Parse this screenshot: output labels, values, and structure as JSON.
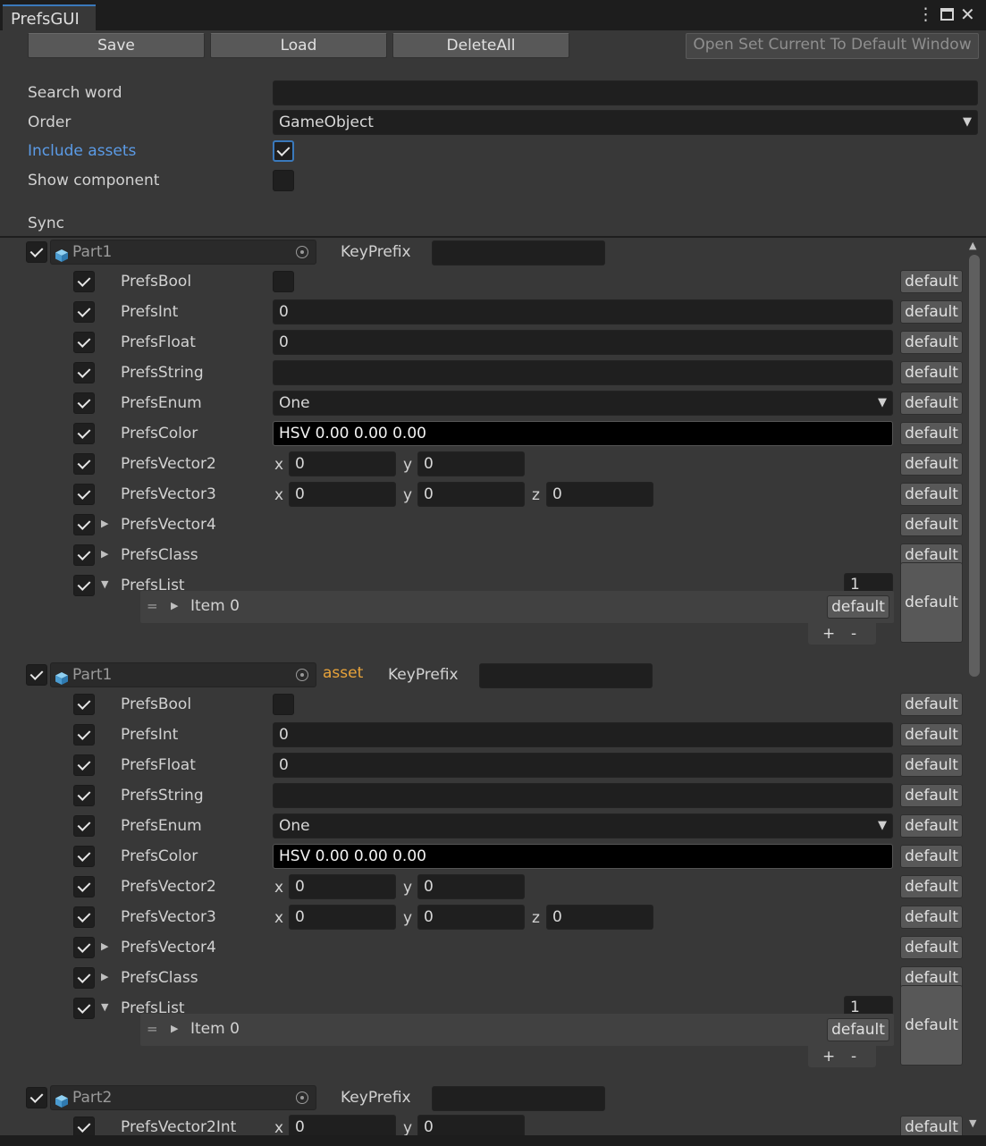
{
  "window": {
    "tab_title": "PrefsGUI"
  },
  "toolbar": {
    "save": "Save",
    "load": "Load",
    "delete_all": "DeleteAll",
    "open_default": "Open Set Current To Default Window"
  },
  "options": {
    "search_label": "Search word",
    "search_value": "",
    "order_label": "Order",
    "order_value": "GameObject",
    "include_assets_label": "Include assets",
    "include_assets_checked": true,
    "show_component_label": "Show component",
    "show_component_checked": false
  },
  "sync_label": "Sync",
  "groups": [
    {
      "object": "Part1",
      "tag": "",
      "keyprefix_label": "KeyPrefix",
      "keyprefix_value": "",
      "checked": true,
      "items": [
        {
          "name": "PrefsBool",
          "type": "bool",
          "value": false
        },
        {
          "name": "PrefsInt",
          "type": "field",
          "value": "0"
        },
        {
          "name": "PrefsFloat",
          "type": "field",
          "value": "0"
        },
        {
          "name": "PrefsString",
          "type": "field",
          "value": ""
        },
        {
          "name": "PrefsEnum",
          "type": "enum",
          "value": "One"
        },
        {
          "name": "PrefsColor",
          "type": "color",
          "value": "HSV 0.00 0.00 0.00"
        },
        {
          "name": "PrefsVector2",
          "type": "vec2",
          "x": "0",
          "y": "0"
        },
        {
          "name": "PrefsVector3",
          "type": "vec3",
          "x": "0",
          "y": "0",
          "z": "0"
        },
        {
          "name": "PrefsVector4",
          "type": "foldout"
        },
        {
          "name": "PrefsClass",
          "type": "foldout"
        },
        {
          "name": "PrefsList",
          "type": "list",
          "count": "1",
          "item": "Item 0"
        }
      ]
    },
    {
      "object": "Part1",
      "tag": "asset",
      "keyprefix_label": "KeyPrefix",
      "keyprefix_value": "",
      "checked": true,
      "items": [
        {
          "name": "PrefsBool",
          "type": "bool",
          "value": false
        },
        {
          "name": "PrefsInt",
          "type": "field",
          "value": "0"
        },
        {
          "name": "PrefsFloat",
          "type": "field",
          "value": "0"
        },
        {
          "name": "PrefsString",
          "type": "field",
          "value": ""
        },
        {
          "name": "PrefsEnum",
          "type": "enum",
          "value": "One"
        },
        {
          "name": "PrefsColor",
          "type": "color",
          "value": "HSV 0.00 0.00 0.00"
        },
        {
          "name": "PrefsVector2",
          "type": "vec2",
          "x": "0",
          "y": "0"
        },
        {
          "name": "PrefsVector3",
          "type": "vec3",
          "x": "0",
          "y": "0",
          "z": "0"
        },
        {
          "name": "PrefsVector4",
          "type": "foldout"
        },
        {
          "name": "PrefsClass",
          "type": "foldout"
        },
        {
          "name": "PrefsList",
          "type": "list",
          "count": "1",
          "item": "Item 0"
        }
      ]
    },
    {
      "object": "Part2",
      "tag": "",
      "keyprefix_label": "KeyPrefix",
      "keyprefix_value": "",
      "checked": true,
      "items": [
        {
          "name": "PrefsVector2Int",
          "type": "vec2",
          "x": "0",
          "y": "0"
        }
      ]
    }
  ],
  "labels": {
    "default": "default",
    "x": "x",
    "y": "y",
    "z": "z",
    "plus": "+",
    "minus": "-"
  },
  "colors": {
    "accent": "#3a79bb",
    "label_link": "#5b9be6",
    "asset_tag": "#e8a33a",
    "cube": "#5aa8d8"
  }
}
